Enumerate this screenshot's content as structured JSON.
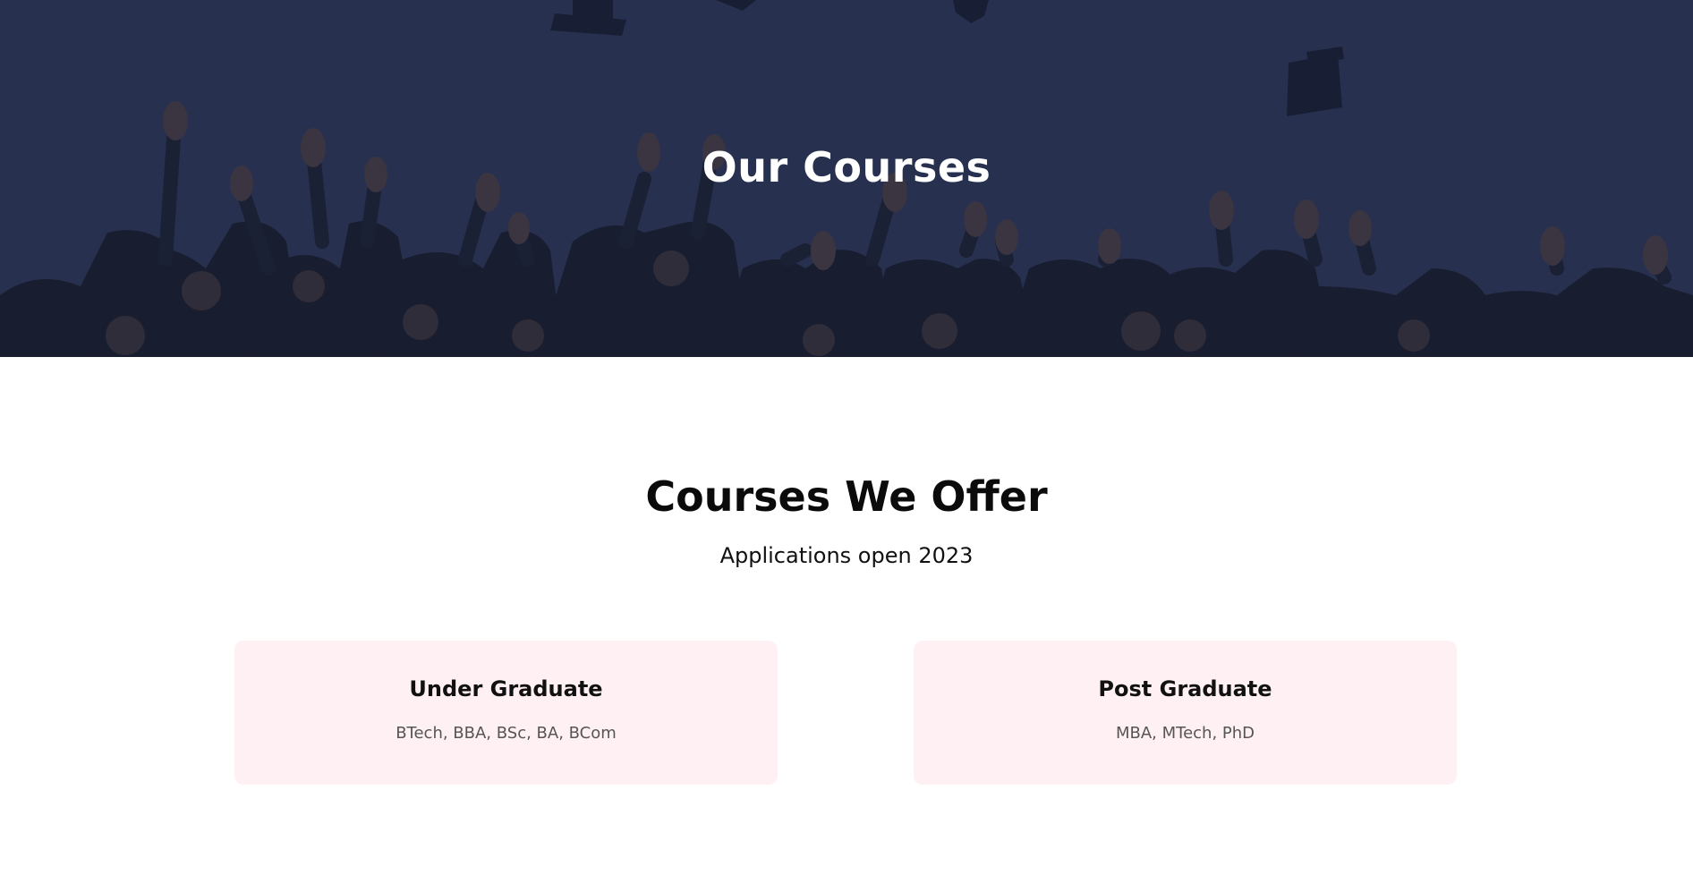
{
  "hero": {
    "title": "Our Courses"
  },
  "offer": {
    "title": "Courses We Offer",
    "subtitle": "Applications open 2023"
  },
  "cards": [
    {
      "title": "Under Graduate",
      "description": "BTech, BBA, BSc, BA, BCom"
    },
    {
      "title": "Post Graduate",
      "description": "MBA, MTech, PhD"
    }
  ],
  "colors": {
    "hero_overlay": "#2c3756",
    "card_background": "#fff1f3",
    "heading_text": "#0b0b0b",
    "body_text": "#555555"
  }
}
